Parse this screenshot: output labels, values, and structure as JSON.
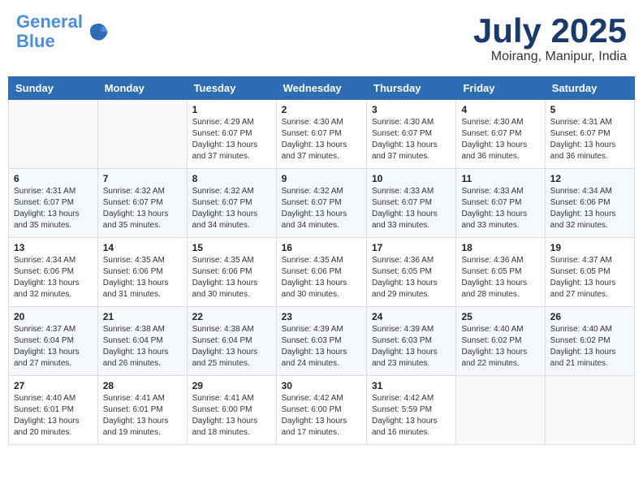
{
  "header": {
    "logo_line1": "General",
    "logo_line2": "Blue",
    "month": "July 2025",
    "location": "Moirang, Manipur, India"
  },
  "weekdays": [
    "Sunday",
    "Monday",
    "Tuesday",
    "Wednesday",
    "Thursday",
    "Friday",
    "Saturday"
  ],
  "weeks": [
    [
      {
        "day": "",
        "info": ""
      },
      {
        "day": "",
        "info": ""
      },
      {
        "day": "1",
        "info": "Sunrise: 4:29 AM\nSunset: 6:07 PM\nDaylight: 13 hours\nand 37 minutes."
      },
      {
        "day": "2",
        "info": "Sunrise: 4:30 AM\nSunset: 6:07 PM\nDaylight: 13 hours\nand 37 minutes."
      },
      {
        "day": "3",
        "info": "Sunrise: 4:30 AM\nSunset: 6:07 PM\nDaylight: 13 hours\nand 37 minutes."
      },
      {
        "day": "4",
        "info": "Sunrise: 4:30 AM\nSunset: 6:07 PM\nDaylight: 13 hours\nand 36 minutes."
      },
      {
        "day": "5",
        "info": "Sunrise: 4:31 AM\nSunset: 6:07 PM\nDaylight: 13 hours\nand 36 minutes."
      }
    ],
    [
      {
        "day": "6",
        "info": "Sunrise: 4:31 AM\nSunset: 6:07 PM\nDaylight: 13 hours\nand 35 minutes."
      },
      {
        "day": "7",
        "info": "Sunrise: 4:32 AM\nSunset: 6:07 PM\nDaylight: 13 hours\nand 35 minutes."
      },
      {
        "day": "8",
        "info": "Sunrise: 4:32 AM\nSunset: 6:07 PM\nDaylight: 13 hours\nand 34 minutes."
      },
      {
        "day": "9",
        "info": "Sunrise: 4:32 AM\nSunset: 6:07 PM\nDaylight: 13 hours\nand 34 minutes."
      },
      {
        "day": "10",
        "info": "Sunrise: 4:33 AM\nSunset: 6:07 PM\nDaylight: 13 hours\nand 33 minutes."
      },
      {
        "day": "11",
        "info": "Sunrise: 4:33 AM\nSunset: 6:07 PM\nDaylight: 13 hours\nand 33 minutes."
      },
      {
        "day": "12",
        "info": "Sunrise: 4:34 AM\nSunset: 6:06 PM\nDaylight: 13 hours\nand 32 minutes."
      }
    ],
    [
      {
        "day": "13",
        "info": "Sunrise: 4:34 AM\nSunset: 6:06 PM\nDaylight: 13 hours\nand 32 minutes."
      },
      {
        "day": "14",
        "info": "Sunrise: 4:35 AM\nSunset: 6:06 PM\nDaylight: 13 hours\nand 31 minutes."
      },
      {
        "day": "15",
        "info": "Sunrise: 4:35 AM\nSunset: 6:06 PM\nDaylight: 13 hours\nand 30 minutes."
      },
      {
        "day": "16",
        "info": "Sunrise: 4:35 AM\nSunset: 6:06 PM\nDaylight: 13 hours\nand 30 minutes."
      },
      {
        "day": "17",
        "info": "Sunrise: 4:36 AM\nSunset: 6:05 PM\nDaylight: 13 hours\nand 29 minutes."
      },
      {
        "day": "18",
        "info": "Sunrise: 4:36 AM\nSunset: 6:05 PM\nDaylight: 13 hours\nand 28 minutes."
      },
      {
        "day": "19",
        "info": "Sunrise: 4:37 AM\nSunset: 6:05 PM\nDaylight: 13 hours\nand 27 minutes."
      }
    ],
    [
      {
        "day": "20",
        "info": "Sunrise: 4:37 AM\nSunset: 6:04 PM\nDaylight: 13 hours\nand 27 minutes."
      },
      {
        "day": "21",
        "info": "Sunrise: 4:38 AM\nSunset: 6:04 PM\nDaylight: 13 hours\nand 26 minutes."
      },
      {
        "day": "22",
        "info": "Sunrise: 4:38 AM\nSunset: 6:04 PM\nDaylight: 13 hours\nand 25 minutes."
      },
      {
        "day": "23",
        "info": "Sunrise: 4:39 AM\nSunset: 6:03 PM\nDaylight: 13 hours\nand 24 minutes."
      },
      {
        "day": "24",
        "info": "Sunrise: 4:39 AM\nSunset: 6:03 PM\nDaylight: 13 hours\nand 23 minutes."
      },
      {
        "day": "25",
        "info": "Sunrise: 4:40 AM\nSunset: 6:02 PM\nDaylight: 13 hours\nand 22 minutes."
      },
      {
        "day": "26",
        "info": "Sunrise: 4:40 AM\nSunset: 6:02 PM\nDaylight: 13 hours\nand 21 minutes."
      }
    ],
    [
      {
        "day": "27",
        "info": "Sunrise: 4:40 AM\nSunset: 6:01 PM\nDaylight: 13 hours\nand 20 minutes."
      },
      {
        "day": "28",
        "info": "Sunrise: 4:41 AM\nSunset: 6:01 PM\nDaylight: 13 hours\nand 19 minutes."
      },
      {
        "day": "29",
        "info": "Sunrise: 4:41 AM\nSunset: 6:00 PM\nDaylight: 13 hours\nand 18 minutes."
      },
      {
        "day": "30",
        "info": "Sunrise: 4:42 AM\nSunset: 6:00 PM\nDaylight: 13 hours\nand 17 minutes."
      },
      {
        "day": "31",
        "info": "Sunrise: 4:42 AM\nSunset: 5:59 PM\nDaylight: 13 hours\nand 16 minutes."
      },
      {
        "day": "",
        "info": ""
      },
      {
        "day": "",
        "info": ""
      }
    ]
  ]
}
